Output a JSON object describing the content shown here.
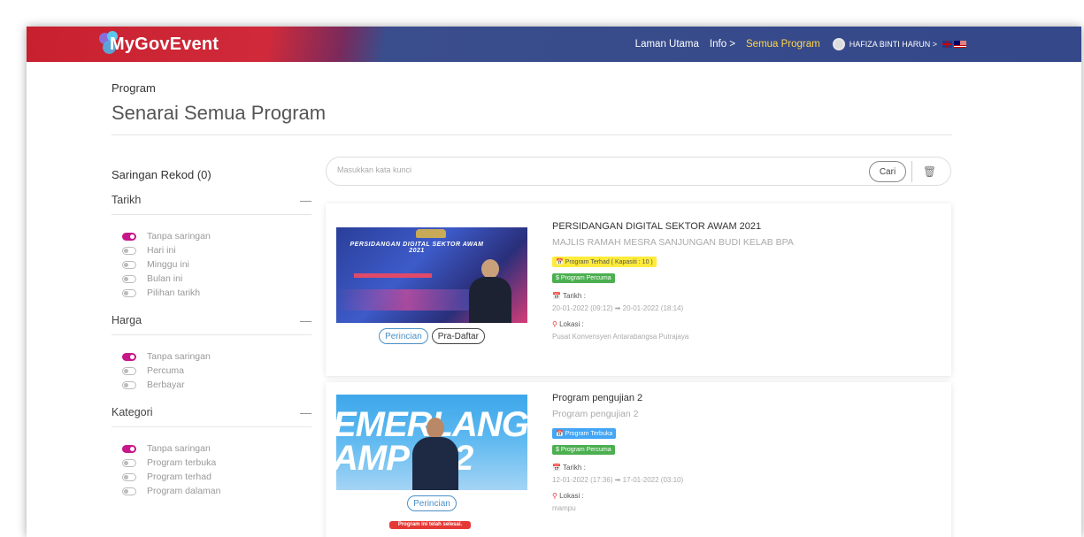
{
  "header": {
    "logo_text": "MyGovEvent",
    "nav": [
      "Laman Utama",
      "Info >",
      "Semua Program"
    ],
    "user": "HAFIZA BINTI HARUN >"
  },
  "page": {
    "breadcrumb": "Program",
    "title": "Senarai Semua Program"
  },
  "filters": {
    "heading": "Saringan Rekod (0)",
    "sections": [
      {
        "title": "Tarikh",
        "options": [
          "Tanpa saringan",
          "Hari ini",
          "Minggu ini",
          "Bulan ini",
          "Pilihan tarikh"
        ]
      },
      {
        "title": "Harga",
        "options": [
          "Tanpa saringan",
          "Percuma",
          "Berbayar"
        ]
      },
      {
        "title": "Kategori",
        "options": [
          "Tanpa saringan",
          "Program terbuka",
          "Program terhad",
          "Program dalaman"
        ]
      }
    ]
  },
  "search": {
    "placeholder": "Masukkan kata kunci",
    "button": "Cari"
  },
  "events": [
    {
      "title": "PERSIDANGAN DIGITAL SEKTOR AWAM 2021",
      "subtitle": "MAJLIS RAMAH MESRA SANJUNGAN BUDI KELAB BPA",
      "badge_type": "📅 Program Terhad ( Kapasiti : 10 )",
      "badge_price": "$ Program Percuma",
      "date_label": "📅 Tarikh :",
      "date_value": "20-01-2022 (09:12) ➡ 20-01-2022 (18:14)",
      "location_label": "Lokasi :",
      "location_value": "Pusat Konvensyen Antarabangsa Putrajaya",
      "btn_detail": "Perincian",
      "btn_register": "Pra-Daftar",
      "poster_title": "PERSIDANGAN DIGITAL SEKTOR AWAM 2021"
    },
    {
      "title": "Program pengujian 2",
      "subtitle": "Program pengujian 2",
      "badge_type": "📅 Program Terbuka",
      "badge_price": "$ Program Percuma",
      "date_label": "📅 Tarikh :",
      "date_value": "12-01-2022 (17:36) ➡ 17-01-2022 (03:10)",
      "location_label": "Lokasi :",
      "location_value": "mampu",
      "btn_detail": "Perincian",
      "ended": "Program ini telah selesai.",
      "poster_line1": "EMERLANG",
      "poster_line2": "AMP 202"
    }
  ],
  "colors": {
    "toggle_on": "#c7178b",
    "header_blue": "#34488a",
    "header_red": "#c8202f",
    "nav_active": "#ffd54a"
  }
}
